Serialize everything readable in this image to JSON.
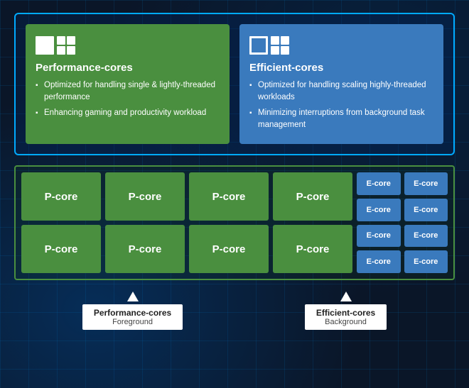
{
  "top_cards": {
    "pcore": {
      "title": "Performance-cores",
      "bullets": [
        "Optimized for handling single & lightly-threaded performance",
        "Enhancing gaming and productivity workload"
      ]
    },
    "ecore": {
      "title": "Efficient-cores",
      "bullets": [
        "Optimized for handling scaling highly-threaded workloads",
        "Minimizing interruptions from background task management"
      ]
    }
  },
  "core_grid": {
    "p_cores": [
      "P-core",
      "P-core",
      "P-core",
      "P-core",
      "P-core",
      "P-core",
      "P-core",
      "P-core"
    ],
    "e_cores": [
      "E-core",
      "E-core",
      "E-core",
      "E-core",
      "E-core",
      "E-core",
      "E-core",
      "E-core"
    ]
  },
  "labels": {
    "pcore": {
      "title": "Performance-cores",
      "subtitle": "Foreground"
    },
    "ecore": {
      "title": "Efficient-cores",
      "subtitle": "Background"
    }
  }
}
